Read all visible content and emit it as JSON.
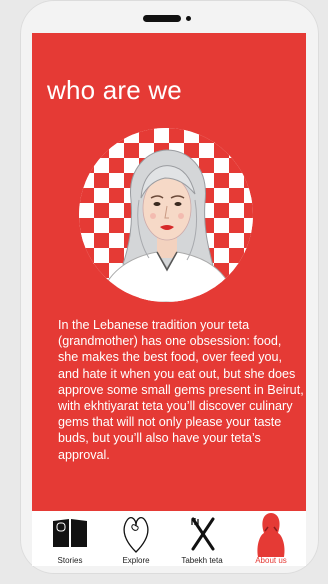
{
  "page": {
    "title": "who are we",
    "description": "In the Lebanese tradition your teta (grandmother) has one obsession: food, she makes the best food, over feed you, and hate it when you eat out, but she does approve some small gems present in Beirut, with ekhtiyarat teta you’ll discover  culinary gems that will not only please your taste buds, but you’ll also have your teta’s approval."
  },
  "nav": {
    "items": [
      {
        "label": "Stories",
        "icon": "book-icon",
        "active": false
      },
      {
        "label": "Explore",
        "icon": "heart-icon",
        "active": false
      },
      {
        "label": "Tabekh teta",
        "icon": "utensils-icon",
        "active": false
      },
      {
        "label": "About us",
        "icon": "teta-icon",
        "active": true
      }
    ]
  },
  "colors": {
    "primary_red": "#e53a35",
    "nav_background": "#ffffff",
    "text_light": "#ffffff"
  }
}
